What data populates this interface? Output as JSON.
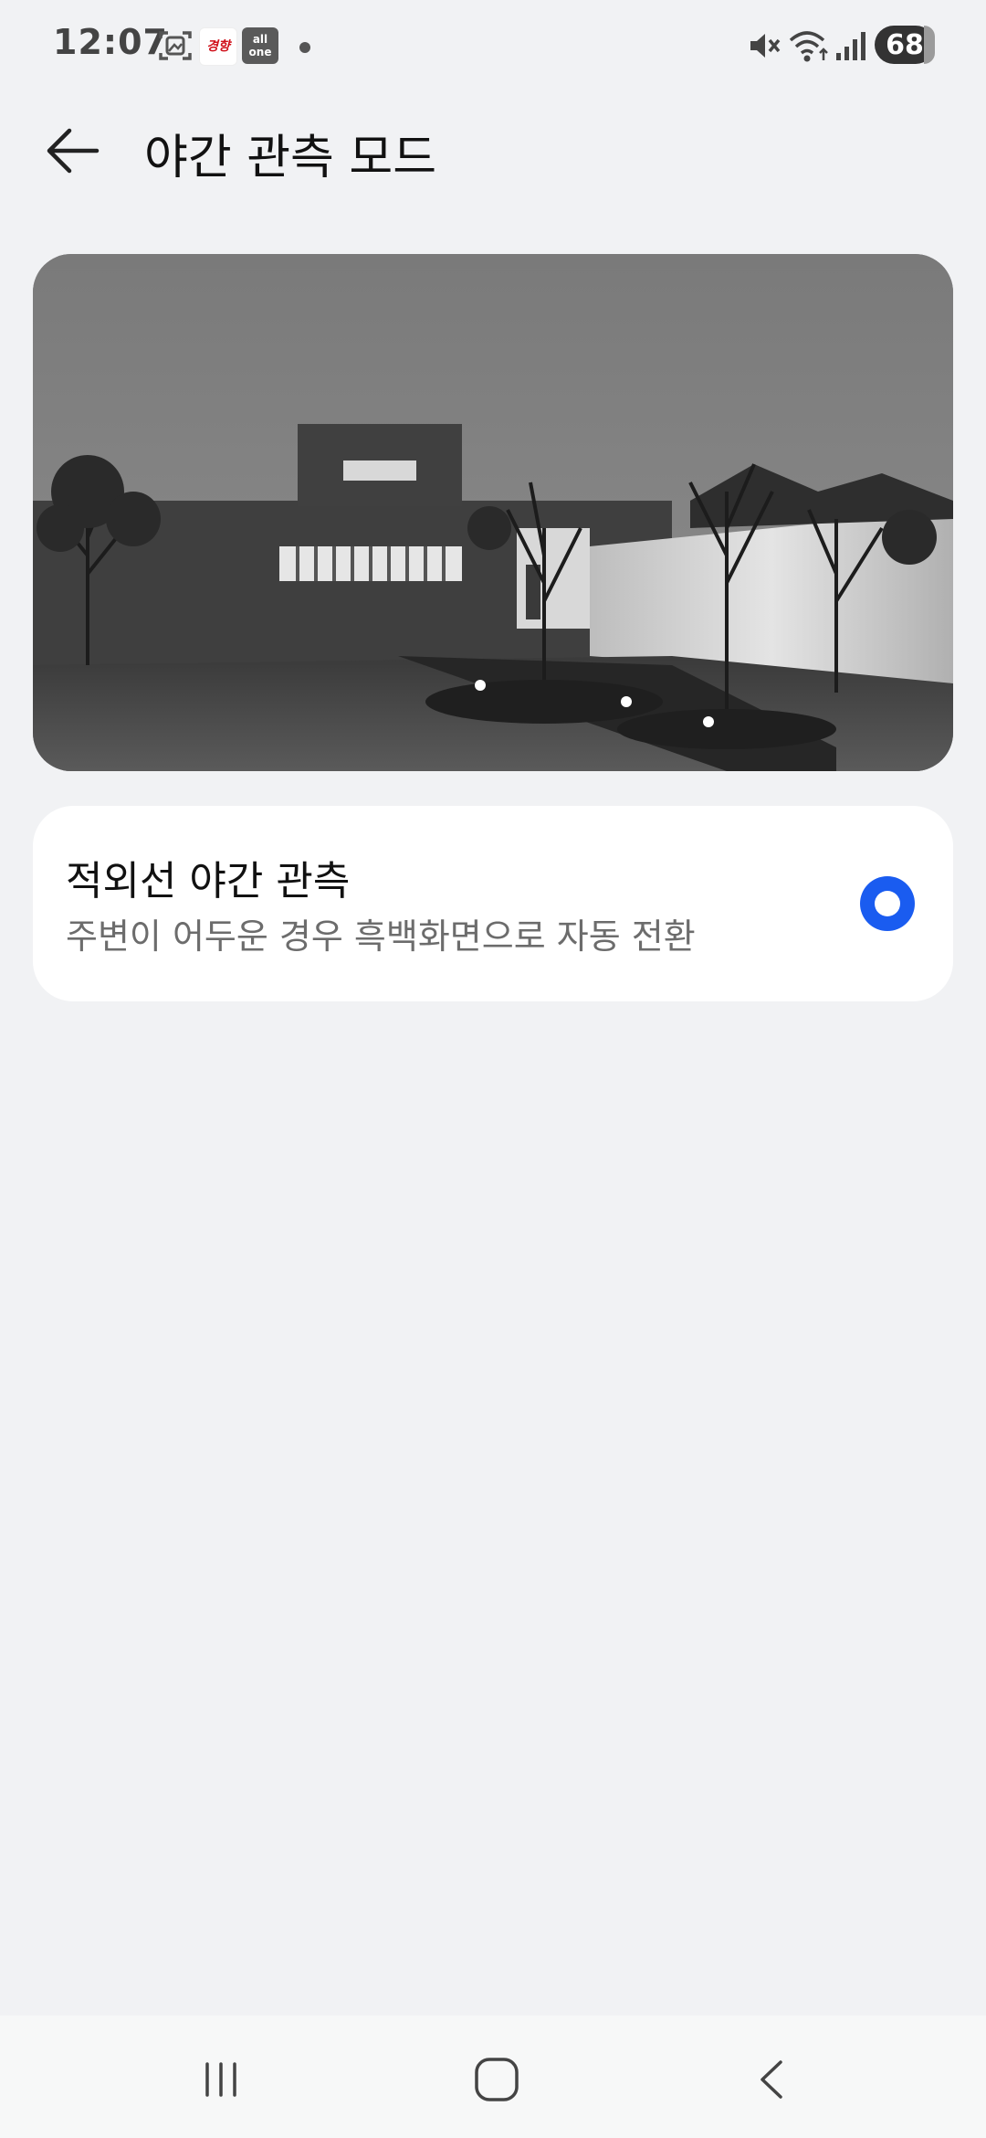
{
  "status_bar": {
    "time": "12:07",
    "notif_badge_1": "경향",
    "notif_badge_2": "all one",
    "battery": "68",
    "icons": [
      "gallery-icon",
      "mute-icon",
      "wifi-icon",
      "signal-icon"
    ]
  },
  "header": {
    "title": "야간 관측 모드",
    "back_icon": "arrow-left-icon"
  },
  "option": {
    "title": "적외선 야간 관측",
    "description": "주변이 어두운 경우 흑백화면으로 자동 전환",
    "selected": true
  },
  "colors": {
    "accent": "#1a5cf0",
    "background": "#f1f2f4",
    "card": "#ffffff"
  },
  "nav": {
    "icons": [
      "recents-icon",
      "home-icon",
      "back-icon"
    ]
  }
}
